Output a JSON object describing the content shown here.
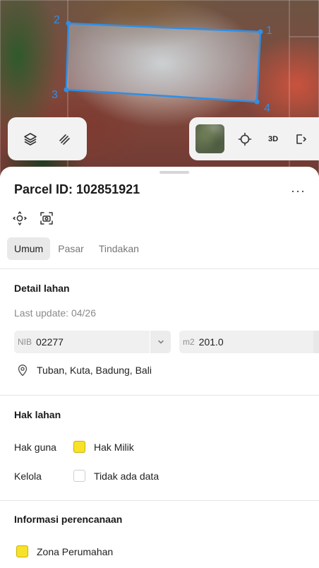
{
  "map": {
    "vertex_labels": [
      "1",
      "2",
      "3",
      "4"
    ]
  },
  "toolbar": {
    "layers_icon": "layers-icon",
    "measure_icon": "ruler-icon",
    "locate_icon": "crosshair-icon",
    "three_d_label": "3D",
    "share_icon": "share-icon"
  },
  "sheet": {
    "title": "Parcel ID: 102851921",
    "more_label": "···",
    "tabs": [
      {
        "label": "Umum",
        "active": true
      },
      {
        "label": "Pasar",
        "active": false
      },
      {
        "label": "Tindakan",
        "active": false
      }
    ],
    "detail": {
      "title": "Detail lahan",
      "last_update": "Last update: 04/26",
      "nib_prefix": "NIB",
      "nib_value": "02277",
      "area_prefix": "m2",
      "area_value": "201.0",
      "location": "Tuban, Kuta, Badung, Bali"
    },
    "rights": {
      "title": "Hak lahan",
      "rows": [
        {
          "label": "Hak guna",
          "value": "Hak Milik",
          "color": "#f7e12a"
        },
        {
          "label": "Kelola",
          "value": "Tidak ada data",
          "color": "#ffffff"
        }
      ]
    },
    "planning": {
      "title": "Informasi perencanaan",
      "zone": "Zona Perumahan",
      "zone_color": "#f7e12a"
    }
  },
  "colors": {
    "accent": "#2e8fe6",
    "zone_yellow": "#f7e12a"
  }
}
